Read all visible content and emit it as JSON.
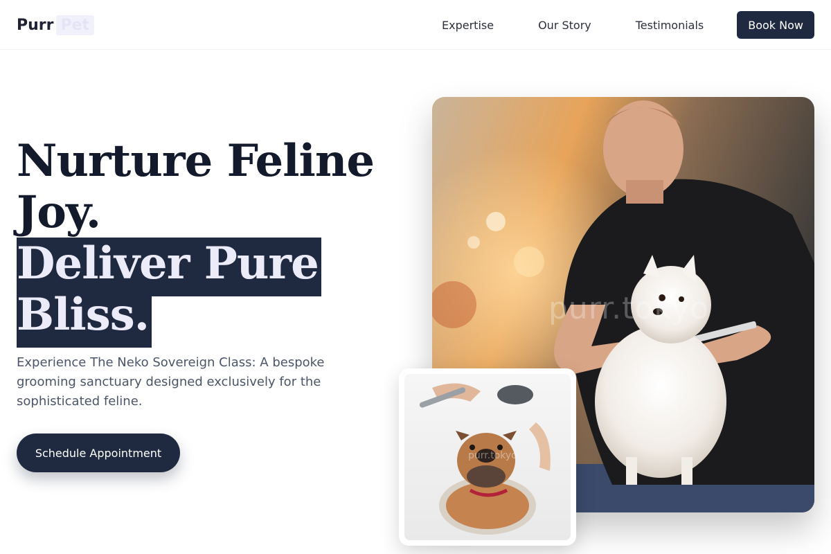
{
  "header": {
    "logo_main": "Purr",
    "logo_accent": "Pet",
    "nav": [
      "Expertise",
      "Our Story",
      "Testimonials"
    ],
    "book_label": "Book Now"
  },
  "hero": {
    "headline_plain": "Nurture Feline Joy.",
    "headline_highlight": "Deliver Pure Bliss.",
    "subtitle": "Experience The Neko Sovereign Class: A bespoke grooming sanctuary designed exclusively for the sophisticated feline.",
    "cta_label": "Schedule Appointment"
  },
  "images": {
    "main_watermark": "purr.tokyo",
    "small_watermark": "purr.tokyo"
  },
  "colors": {
    "primary": "#1f2a40",
    "headline": "#131a2c",
    "highlight_text": "#ecebf9",
    "subtitle": "#4a5569"
  }
}
